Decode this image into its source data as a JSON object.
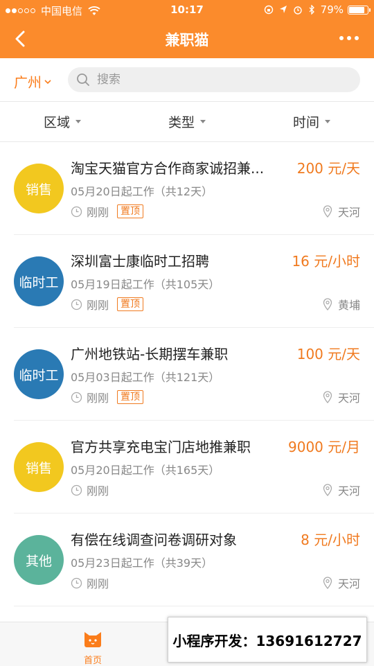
{
  "status_bar": {
    "carrier": "中国电信",
    "time": "10:17",
    "battery": "79%",
    "battery_level": 0.79
  },
  "nav": {
    "title": "兼职猫"
  },
  "search": {
    "city": "广州",
    "placeholder": "搜索"
  },
  "filters": [
    {
      "label": "区域"
    },
    {
      "label": "类型"
    },
    {
      "label": "时间"
    }
  ],
  "jobs": [
    {
      "category": "销售",
      "color": "#f2c81f",
      "title": "淘宝天猫官方合作商家诚招兼...",
      "salary": "200 元/天",
      "date": "05月20日起工作（共12天）",
      "posted": "刚刚",
      "tag": "置顶",
      "location": "天河"
    },
    {
      "category": "临时工",
      "color": "#2a7ab4",
      "title": "深圳富士康临时工招聘",
      "salary": "16 元/小时",
      "date": "05月19日起工作（共105天）",
      "posted": "刚刚",
      "tag": "置顶",
      "location": "黄埔"
    },
    {
      "category": "临时工",
      "color": "#2a7ab4",
      "title": "广州地铁站-长期摆车兼职",
      "salary": "100 元/天",
      "date": "05月03日起工作（共121天）",
      "posted": "刚刚",
      "tag": "置顶",
      "location": "天河"
    },
    {
      "category": "销售",
      "color": "#f2c81f",
      "title": "官方共享充电宝门店地推兼职",
      "salary": "9000 元/月",
      "date": "05月20日起工作（共165天）",
      "posted": "刚刚",
      "tag": "",
      "location": "天河"
    },
    {
      "category": "其他",
      "color": "#5bb39b",
      "title": "有偿在线调查问卷调研对象",
      "salary": "8 元/小时",
      "date": "05月23日起工作（共39天）",
      "posted": "刚刚",
      "tag": "",
      "location": "天河"
    }
  ],
  "tabbar": {
    "home_label": "首页"
  },
  "banner": {
    "text": "小程序开发：13691612727"
  },
  "colors": {
    "brand": "#fb8b2c",
    "accent": "#f07a1f"
  }
}
